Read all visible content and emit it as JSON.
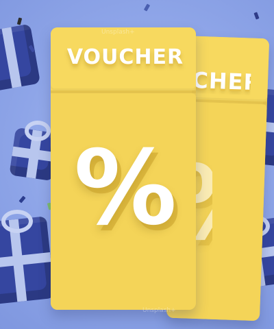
{
  "image": {
    "voucher_front_text": "VOUCHER",
    "voucher_back_text": "VOUCHER",
    "symbol": "%",
    "watermark_text": "Unsplash+",
    "colors": {
      "background": "#8fa6ea",
      "ticket": "#f5d45a",
      "gift_box": "#3546a0",
      "ribbon": "#c7d2f3",
      "text": "#ffffff"
    }
  }
}
